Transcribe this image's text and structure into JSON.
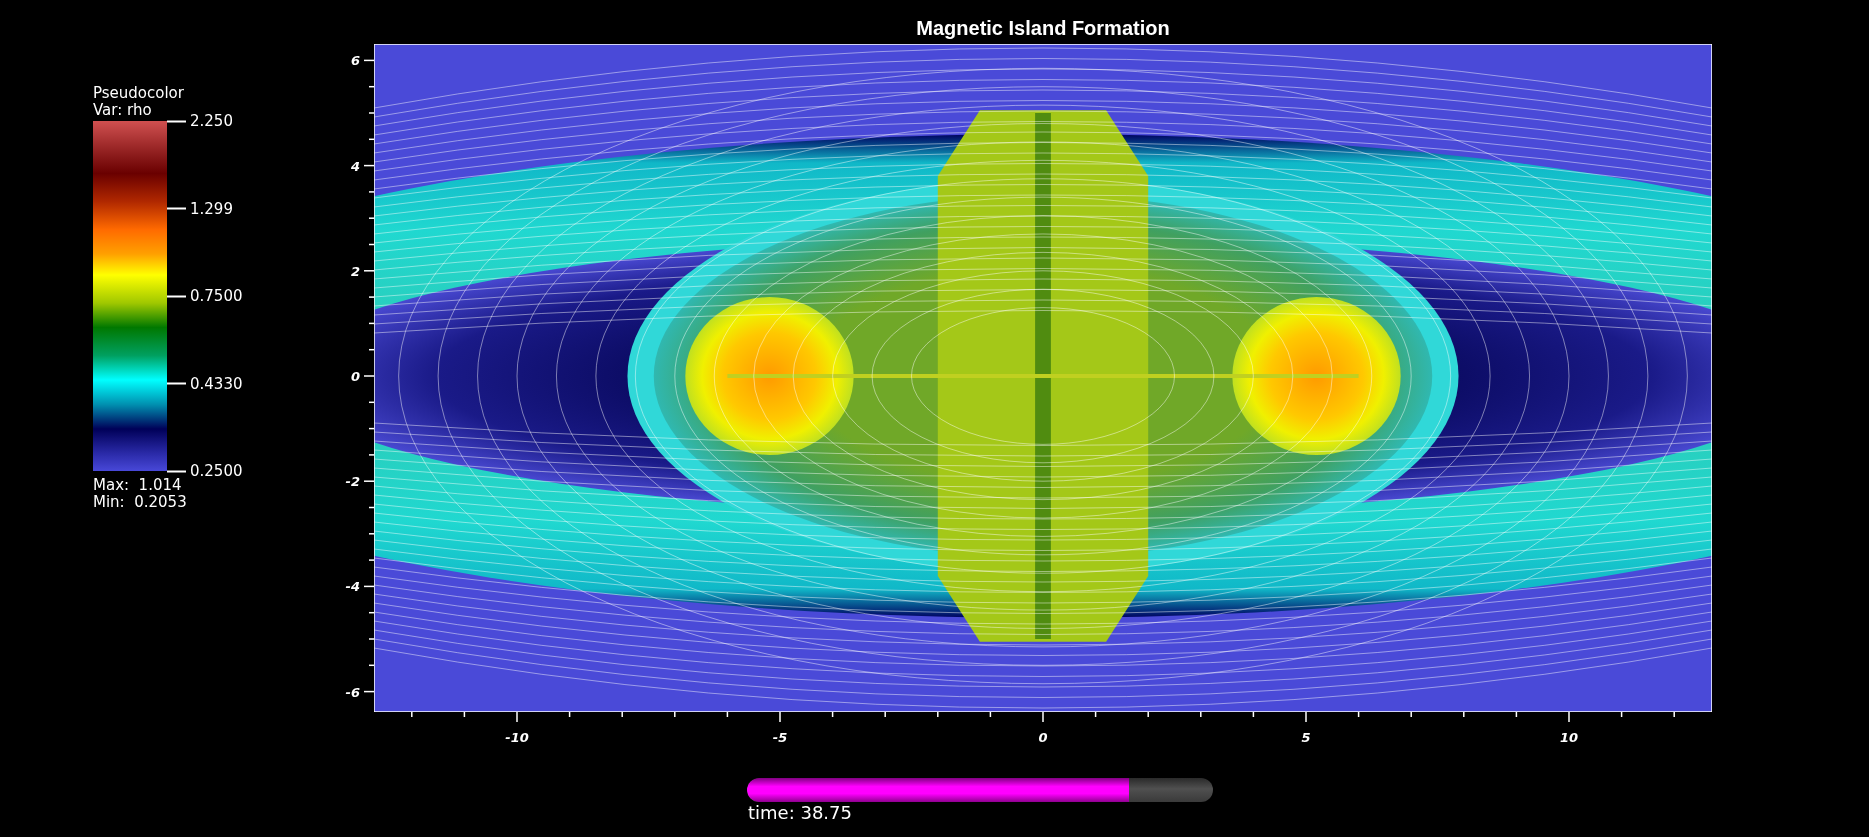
{
  "title": "Magnetic Island Formation",
  "legend": {
    "plot": "Pseudocolor",
    "variable": "Var: rho",
    "ticks": [
      "2.250",
      "1.299",
      "0.7500",
      "0.4330",
      "0.2500"
    ],
    "max": "Max:  1.014",
    "min": "Min:  0.2053"
  },
  "axes": {
    "y_ticks": [
      "6",
      "4",
      "2",
      "0",
      "-2",
      "-4",
      "-6"
    ],
    "x_ticks": [
      "-10",
      "-5",
      "0",
      "5",
      "10"
    ]
  },
  "time_slider": {
    "level": 0.82,
    "label": "time: 38.75"
  }
}
